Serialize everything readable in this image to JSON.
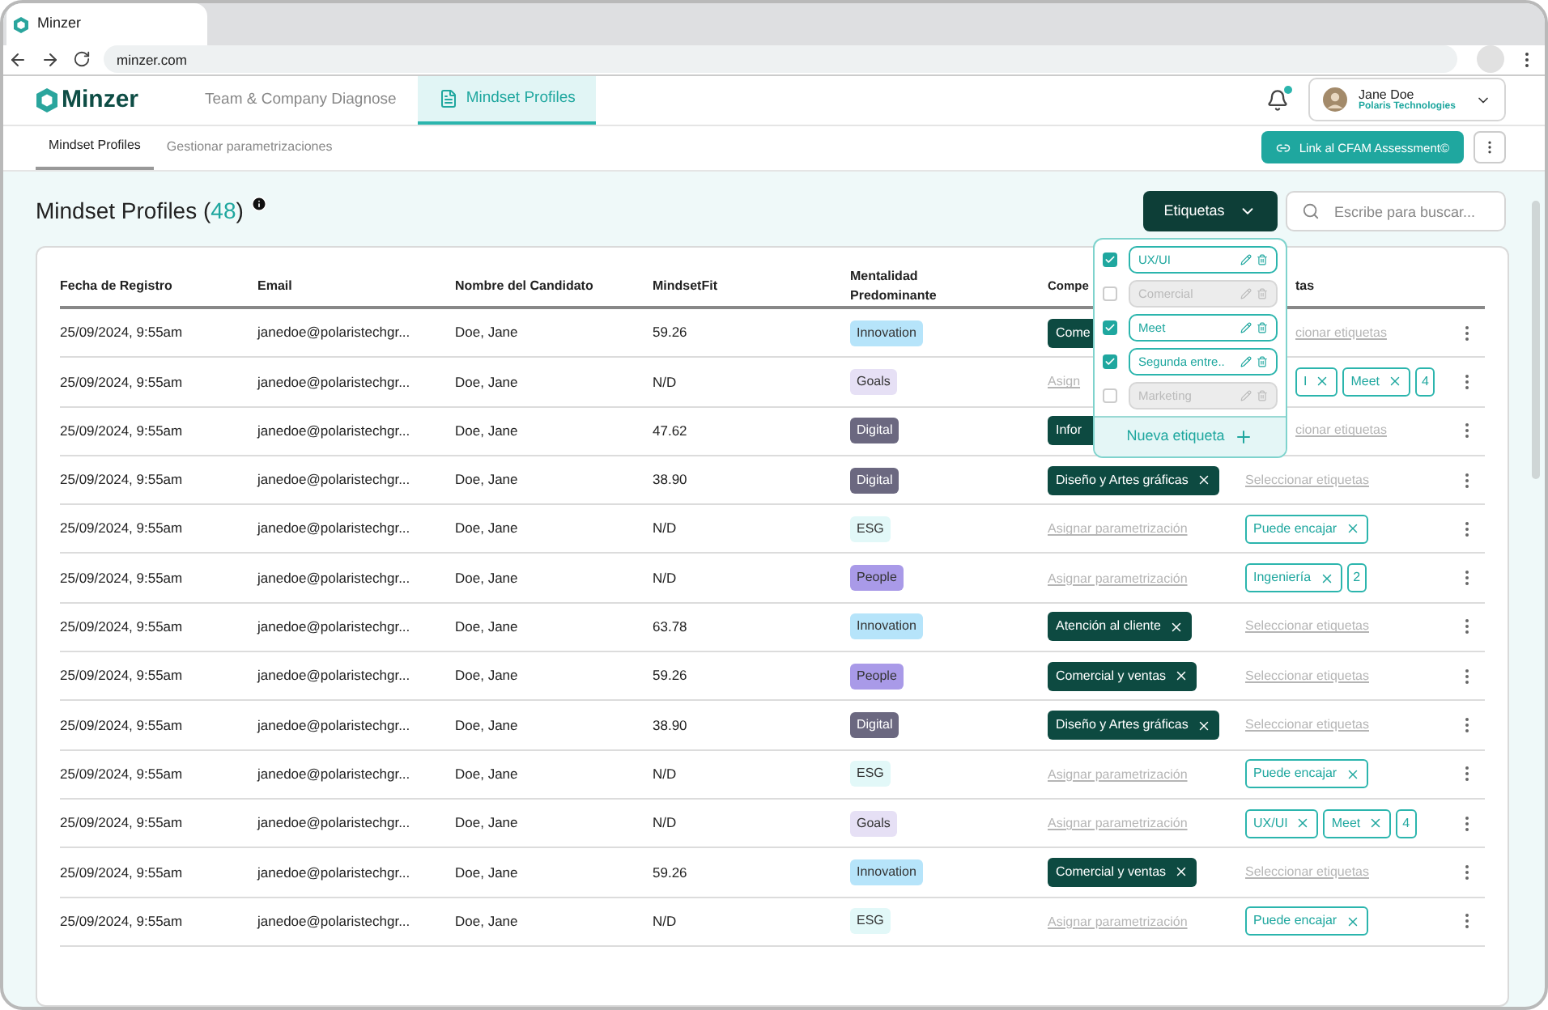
{
  "browser": {
    "tab_title": "Minzer",
    "url": "minzer.com"
  },
  "app_header": {
    "logo": "Minzer",
    "nav": [
      {
        "label": "Team & Company Diagnose",
        "selected": false
      },
      {
        "label": "Mindset Profiles",
        "selected": true
      }
    ],
    "user": {
      "name": "Jane Doe",
      "company": "Polaris Technologies"
    }
  },
  "subnav": {
    "tabs": [
      {
        "label": "Mindset Profiles",
        "selected": true
      },
      {
        "label": "Gestionar parametrizaciones",
        "selected": false
      }
    ],
    "cfam_button": "Link al CFAM Assessment©"
  },
  "page": {
    "title": "Mindset Profiles (",
    "count": "48",
    "title_end": ")",
    "tags_button": "Etiquetas",
    "search": {
      "placeholder": "Escribe para buscar..."
    }
  },
  "table": {
    "columns": [
      "Fecha de Registro",
      "Email",
      "Nombre del Candidato",
      "MindsetFit",
      "Mentalidad Predominante",
      "Compe",
      "tas"
    ],
    "rows": [
      {
        "date": "25/09/2024, 9:55am",
        "email": "janedoe@polaristechgr...",
        "name": "Doe, Jane",
        "fit": "59.26",
        "mentality": {
          "label": "Innovation",
          "color": "#b6e4fa"
        },
        "competence": {
          "kind": "chip",
          "text": "Come"
        },
        "tags": {
          "kind": "link",
          "text": "cionar etiquetas"
        }
      },
      {
        "date": "25/09/2024, 9:55am",
        "email": "janedoe@polaristechgr...",
        "name": "Doe, Jane",
        "fit": "N/D",
        "mentality": {
          "label": "Goals",
          "color": "#e6e0f5"
        },
        "competence": {
          "kind": "link",
          "text": "Asign"
        },
        "tags": {
          "kind": "chips",
          "items": [
            "I",
            "Meet"
          ],
          "more": "4"
        }
      },
      {
        "date": "25/09/2024, 9:55am",
        "email": "janedoe@polaristechgr...",
        "name": "Doe, Jane",
        "fit": "47.62",
        "mentality": {
          "label": "Digital",
          "color": "#6b6880"
        },
        "competence": {
          "kind": "chip",
          "text": "Infor"
        },
        "tags": {
          "kind": "link",
          "text": "cionar etiquetas"
        }
      },
      {
        "date": "25/09/2024, 9:55am",
        "email": "janedoe@polaristechgr...",
        "name": "Doe, Jane",
        "fit": "38.90",
        "mentality": {
          "label": "Digital",
          "color": "#6b6880"
        },
        "competence": {
          "kind": "chip",
          "text": "Diseño y Artes gráficas"
        },
        "tags": {
          "kind": "link",
          "text": "Seleccionar etiquetas"
        }
      },
      {
        "date": "25/09/2024, 9:55am",
        "email": "janedoe@polaristechgr...",
        "name": "Doe, Jane",
        "fit": "N/D",
        "mentality": {
          "label": "ESG",
          "color": "#e2f8f8"
        },
        "competence": {
          "kind": "link",
          "text": "Asignar parametrización"
        },
        "tags": {
          "kind": "chips",
          "items": [
            "Puede encajar"
          ]
        }
      },
      {
        "date": "25/09/2024, 9:55am",
        "email": "janedoe@polaristechgr...",
        "name": "Doe, Jane",
        "fit": "N/D",
        "mentality": {
          "label": "People",
          "color": "#a99ae8"
        },
        "competence": {
          "kind": "link",
          "text": "Asignar parametrización"
        },
        "tags": {
          "kind": "chips",
          "items": [
            "Ingeniería"
          ],
          "more": "2"
        }
      },
      {
        "date": "25/09/2024, 9:55am",
        "email": "janedoe@polaristechgr...",
        "name": "Doe, Jane",
        "fit": "63.78",
        "mentality": {
          "label": "Innovation",
          "color": "#b6e4fa"
        },
        "competence": {
          "kind": "chip",
          "text": "Atención al cliente"
        },
        "tags": {
          "kind": "link",
          "text": "Seleccionar etiquetas"
        }
      },
      {
        "date": "25/09/2024, 9:55am",
        "email": "janedoe@polaristechgr...",
        "name": "Doe, Jane",
        "fit": "59.26",
        "mentality": {
          "label": "People",
          "color": "#a99ae8"
        },
        "competence": {
          "kind": "chip",
          "text": "Comercial y ventas"
        },
        "tags": {
          "kind": "link",
          "text": "Seleccionar etiquetas"
        }
      },
      {
        "date": "25/09/2024, 9:55am",
        "email": "janedoe@polaristechgr...",
        "name": "Doe, Jane",
        "fit": "38.90",
        "mentality": {
          "label": "Digital",
          "color": "#6b6880"
        },
        "competence": {
          "kind": "chip",
          "text": "Diseño y Artes gráficas"
        },
        "tags": {
          "kind": "link",
          "text": "Seleccionar etiquetas"
        }
      },
      {
        "date": "25/09/2024, 9:55am",
        "email": "janedoe@polaristechgr...",
        "name": "Doe, Jane",
        "fit": "N/D",
        "mentality": {
          "label": "ESG",
          "color": "#e2f8f8"
        },
        "competence": {
          "kind": "link",
          "text": "Asignar parametrización"
        },
        "tags": {
          "kind": "chips",
          "items": [
            "Puede encajar"
          ]
        }
      },
      {
        "date": "25/09/2024, 9:55am",
        "email": "janedoe@polaristechgr...",
        "name": "Doe, Jane",
        "fit": "N/D",
        "mentality": {
          "label": "Goals",
          "color": "#e6e0f5"
        },
        "competence": {
          "kind": "link",
          "text": "Asignar parametrización"
        },
        "tags": {
          "kind": "chips",
          "items": [
            "UX/UI",
            "Meet"
          ],
          "more": "4"
        }
      },
      {
        "date": "25/09/2024, 9:55am",
        "email": "janedoe@polaristechgr...",
        "name": "Doe, Jane",
        "fit": "59.26",
        "mentality": {
          "label": "Innovation",
          "color": "#b6e4fa"
        },
        "competence": {
          "kind": "chip",
          "text": "Comercial y ventas"
        },
        "tags": {
          "kind": "link",
          "text": "Seleccionar etiquetas"
        }
      },
      {
        "date": "25/09/2024, 9:55am",
        "email": "janedoe@polaristechgr...",
        "name": "Doe, Jane",
        "fit": "N/D",
        "mentality": {
          "label": "ESG",
          "color": "#e2f8f8"
        },
        "competence": {
          "kind": "link",
          "text": "Asignar parametrización"
        },
        "tags": {
          "kind": "chips",
          "items": [
            "Puede encajar"
          ]
        }
      }
    ]
  },
  "tag_menu": {
    "items": [
      {
        "label": "UX/UI",
        "checked": true
      },
      {
        "label": "Comercial",
        "checked": false
      },
      {
        "label": "Meet",
        "checked": true
      },
      {
        "label": "Segunda entre..",
        "checked": true
      },
      {
        "label": "Marketing",
        "checked": false
      }
    ],
    "new_label": "Nueva etiqueta"
  }
}
